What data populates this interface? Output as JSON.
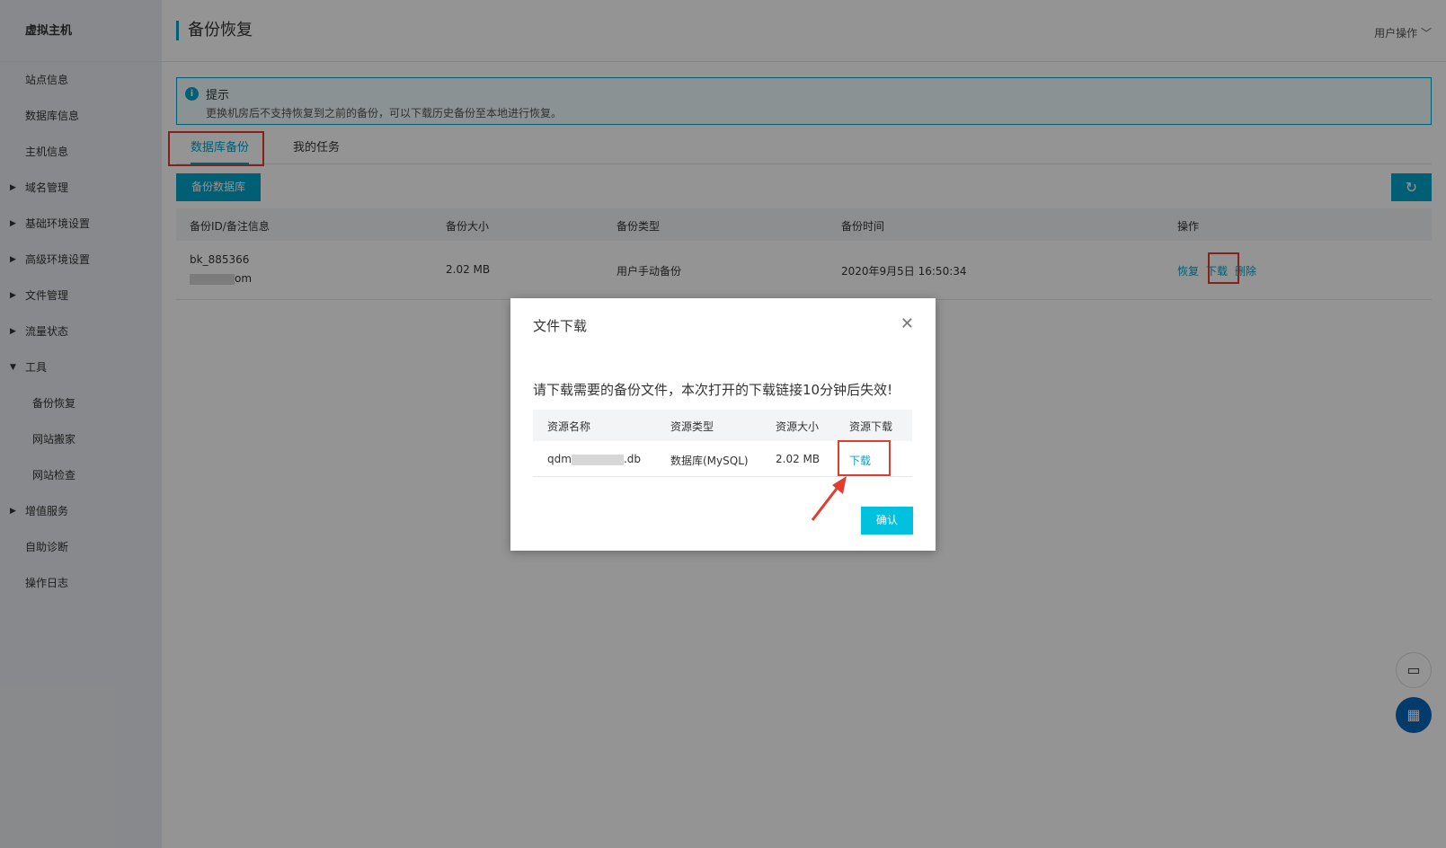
{
  "sidebar": {
    "brand": "虚拟主机",
    "items": [
      {
        "label": "站点信息"
      },
      {
        "label": "数据库信息"
      },
      {
        "label": "主机信息"
      },
      {
        "label": "域名管理"
      },
      {
        "label": "基础环境设置"
      },
      {
        "label": "高级环境设置"
      },
      {
        "label": "文件管理"
      },
      {
        "label": "流量状态"
      },
      {
        "label": "工具"
      },
      {
        "label": "备份恢复"
      },
      {
        "label": "网站搬家"
      },
      {
        "label": "网站检查"
      },
      {
        "label": "增值服务"
      },
      {
        "label": "自助诊断"
      },
      {
        "label": "操作日志"
      }
    ]
  },
  "header": {
    "title": "备份恢复",
    "user_ops": "用户操作"
  },
  "tip": {
    "title": "提示",
    "text": "更换机房后不支持恢复到之前的备份，可以下载历史备份至本地进行恢复。"
  },
  "tabs": [
    {
      "label": "数据库备份"
    },
    {
      "label": "我的任务"
    }
  ],
  "toolbar": {
    "backup_button": "备份数据库"
  },
  "table": {
    "columns": [
      "备份ID/备注信息",
      "备份大小",
      "备份类型",
      "备份时间",
      "操作"
    ],
    "rows": [
      {
        "id": "bk_885366",
        "note_suffix": "om",
        "size": "2.02 MB",
        "type": "用户手动备份",
        "time": "2020年9月5日 16:50:34",
        "actions": [
          "恢复",
          "下载",
          "删除"
        ]
      }
    ]
  },
  "modal": {
    "title": "文件下载",
    "message": "请下载需要的备份文件，本次打开的下载链接10分钟后失效!",
    "columns": [
      "资源名称",
      "资源类型",
      "资源大小",
      "资源下载"
    ],
    "rows": [
      {
        "name_prefix": "qdm",
        "name_suffix": ".db",
        "type": "数据库(MySQL)",
        "size": "2.02 MB",
        "download": "下载"
      }
    ],
    "confirm": "确认"
  },
  "colors": {
    "accent": "#00a2ca",
    "highlight": "#e23c2e",
    "confirm": "#00c1de"
  }
}
